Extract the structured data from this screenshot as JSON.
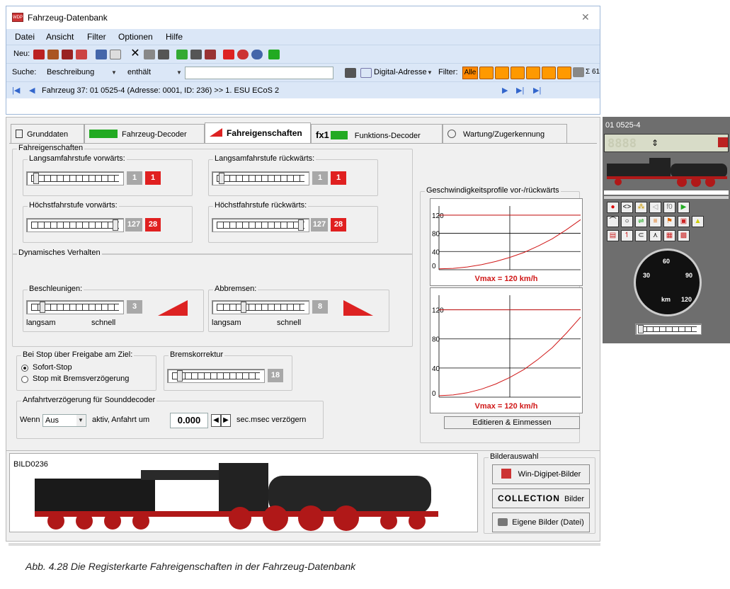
{
  "window": {
    "title": "Fahrzeug-Datenbank",
    "close": "✕"
  },
  "menu": [
    "Datei",
    "Ansicht",
    "Filter",
    "Optionen",
    "Hilfe"
  ],
  "toolbar": {
    "neu_label": "Neu:"
  },
  "search": {
    "label": "Suche:",
    "field": "Beschreibung",
    "mode": "enthält",
    "value": "",
    "sort_field": "Digital-Adresse",
    "filter_label": "Filter:",
    "filter_all": "Alle",
    "count": "Σ 61"
  },
  "nav": {
    "text": "Fahrzeug 37: 01 0525-4 (Adresse: 0001, ID: 236) >> 1. ESU ECoS 2"
  },
  "tabs": [
    {
      "label": "Grunddaten"
    },
    {
      "label": "Fahrzeug-Decoder"
    },
    {
      "label": "Fahreigenschaften"
    },
    {
      "label": "Funktions-Decoder",
      "prefix": "fx1"
    },
    {
      "label": "Wartung/Zugerkennung"
    }
  ],
  "fahreigenschaften": {
    "group_label": "Fahreigenschaften",
    "langsam_vor": {
      "label": "Langsamfahrstufe vorwärts:",
      "grey": "1",
      "red": "1",
      "level": 0.05
    },
    "langsam_rueck": {
      "label": "Langsamfahrstufe rückwärts:",
      "grey": "1",
      "red": "1",
      "level": 0.05
    },
    "hoechst_vor": {
      "label": "Höchstfahrstufe vorwärts:",
      "grey": "127",
      "red": "28",
      "level": 0.97
    },
    "hoechst_rueck": {
      "label": "Höchstfahrstufe rückwärts:",
      "grey": "127",
      "red": "28",
      "level": 0.97
    }
  },
  "dynamisch": {
    "group_label": "Dynamisches Verhalten",
    "beschleunigen": {
      "label": "Beschleunigen:",
      "value": "3",
      "level": 0.12,
      "min": "langsam",
      "max": "schnell"
    },
    "abbremsen": {
      "label": "Abbremsen:",
      "value": "8",
      "level": 0.3,
      "min": "langsam",
      "max": "schnell"
    }
  },
  "stop": {
    "group_label": "Bei Stop über Freigabe am Ziel:",
    "opt1": "Sofort-Stop",
    "opt2": "Stop mit Bremsverzögerung"
  },
  "bremskorrektur": {
    "group_label": "Bremskorrektur",
    "value": "18",
    "level": 0.08
  },
  "anfahrt": {
    "group_label": "Anfahrtverzögerung für Sounddecoder",
    "wenn": "Wenn",
    "select": "Aus",
    "mid": "aktiv, Anfahrt um",
    "value": "0.000",
    "suffix": "sec.msec verzögern"
  },
  "profiles": {
    "group_label": "Geschwindigkeitsprofile vor-/rückwärts",
    "ticks": [
      "120",
      "80",
      "40",
      "0"
    ],
    "vmax_label": "Vmax = 120 km/h",
    "button": "Editieren & Einmessen"
  },
  "chart_data": [
    {
      "type": "line",
      "title": "Vmax = 120 km/h",
      "ylim": [
        0,
        140
      ],
      "y_ticks": [
        0,
        40,
        80,
        120
      ],
      "xlim": [
        0,
        1
      ],
      "series": [
        {
          "x": [
            0,
            0.1,
            0.2,
            0.3,
            0.4,
            0.5,
            0.6,
            0.7,
            0.8,
            0.9,
            1.0
          ],
          "y": [
            2,
            3,
            6,
            11,
            18,
            27,
            38,
            52,
            68,
            88,
            110
          ]
        },
        {
          "x": [
            0,
            1
          ],
          "y": [
            120,
            120
          ]
        }
      ]
    },
    {
      "type": "line",
      "title": "Vmax = 120 km/h",
      "ylim": [
        0,
        140
      ],
      "y_ticks": [
        0,
        40,
        80,
        120
      ],
      "xlim": [
        0,
        1
      ],
      "series": [
        {
          "x": [
            0,
            0.1,
            0.2,
            0.3,
            0.4,
            0.5,
            0.6,
            0.7,
            0.8,
            0.9,
            1.0
          ],
          "y": [
            2,
            3,
            6,
            11,
            18,
            27,
            38,
            52,
            68,
            88,
            110
          ]
        },
        {
          "x": [
            0,
            1
          ],
          "y": [
            120,
            120
          ]
        }
      ]
    }
  ],
  "bild": {
    "name": "BILD0236",
    "group_label": "Bilderauswahl",
    "btn1": "Win-Digipet-Bilder",
    "btn2_logo": "COLLECTION",
    "btn2": "Bilder",
    "btn3": "Eigene Bilder (Datei)"
  },
  "side": {
    "title": "01 0525-4",
    "digits": "8888",
    "speed_ticks": [
      "30",
      "60",
      "90",
      "120"
    ],
    "speed_unit": "km",
    "fn_label": "f0"
  },
  "caption": "Abb. 4.28 Die Registerkarte Fahreigenschaften in der Fahrzeug-Datenbank"
}
